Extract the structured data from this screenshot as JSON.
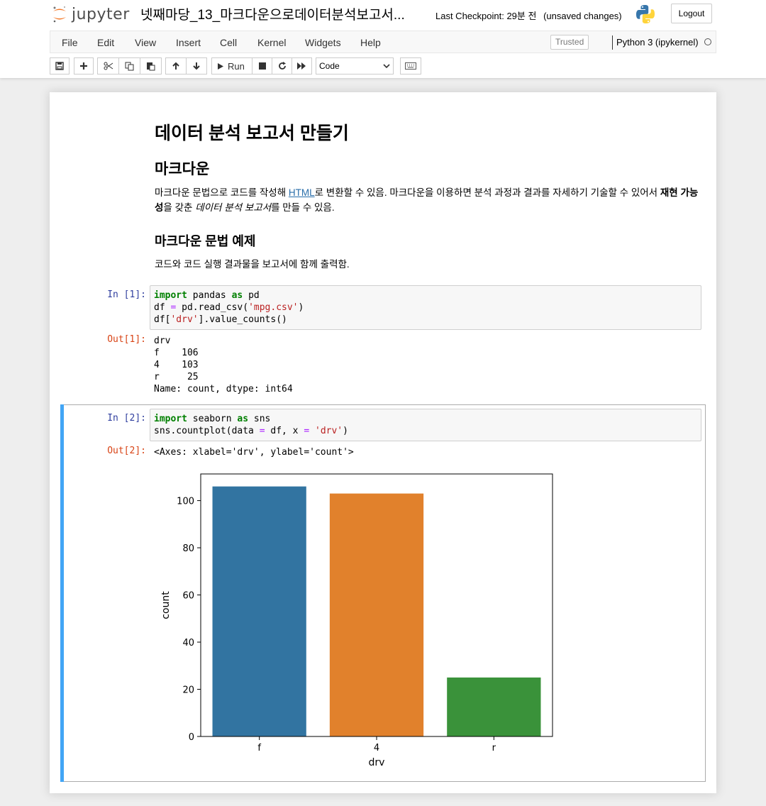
{
  "header": {
    "logo_text": "jupyter",
    "notebook_title": "넷째마당_13_마크다운으로데이터분석보고서...",
    "checkpoint": "Last Checkpoint: 29분 전",
    "unsaved": "(unsaved changes)",
    "logout_label": "Logout"
  },
  "menu": {
    "items": [
      "File",
      "Edit",
      "View",
      "Insert",
      "Cell",
      "Kernel",
      "Widgets",
      "Help"
    ],
    "trusted_label": "Trusted",
    "kernel_name": "Python 3 (ipykernel)"
  },
  "toolbar": {
    "run_label": "Run",
    "cell_type": "Code",
    "buttons": [
      "save-icon",
      "plus-icon",
      "cut-icon",
      "copy-icon",
      "paste-icon",
      "arrow-up-icon",
      "arrow-down-icon",
      "run-icon",
      "stop-icon",
      "restart-icon",
      "fast-forward-icon",
      "keyboard-icon"
    ]
  },
  "markdown": {
    "h1": "데이터 분석 보고서 만들기",
    "h2": "마크다운",
    "p1_a": "마크다운 문법으로 코드를 작성해 ",
    "p1_link": "HTML",
    "p1_b": "로 변환할 수 있음. 마크다운을 이용하면 분석 과정과 결과를 자세하기 기술할 수 있어서 ",
    "p1_bold": "재현 가능성",
    "p1_c": "을 갖춘 ",
    "p1_em": "데이터 분석 보고서",
    "p1_d": "를 만들 수 있음.",
    "h3": "마크다운 문법 예제",
    "p2": "코드와 코드 실행 결과물을 보고서에 함께 출력함."
  },
  "cells": {
    "in1_prompt": "In [1]:",
    "in1_line1_kw1": "import",
    "in1_line1_a": " pandas ",
    "in1_line1_kw2": "as",
    "in1_line1_b": " pd",
    "in1_line2_a": "df ",
    "in1_line2_op": "=",
    "in1_line2_b": " pd.read_csv(",
    "in1_line2_str": "'mpg.csv'",
    "in1_line2_c": ")",
    "in1_line3_a": "df[",
    "in1_line3_str": "'drv'",
    "in1_line3_b": "].value_counts()",
    "out1_prompt": "Out[1]:",
    "out1_text": "drv\nf    106\n4    103\nr     25\nName: count, dtype: int64",
    "in2_prompt": "In [2]:",
    "in2_line1_kw1": "import",
    "in2_line1_a": " seaborn ",
    "in2_line1_kw2": "as",
    "in2_line1_b": " sns",
    "in2_line2_a": "sns.countplot(data ",
    "in2_line2_op1": "=",
    "in2_line2_b": " df, x ",
    "in2_line2_op2": "=",
    "in2_line2_c": " ",
    "in2_line2_str": "'drv'",
    "in2_line2_d": ")",
    "out2_prompt": "Out[2]:",
    "out2_text": "<Axes: xlabel='drv', ylabel='count'>"
  },
  "chart_data": {
    "type": "bar",
    "categories": [
      "f",
      "4",
      "r"
    ],
    "values": [
      106,
      103,
      25
    ],
    "colors": [
      "#3274a1",
      "#e1812c",
      "#3a923a"
    ],
    "xlabel": "drv",
    "ylabel": "count",
    "ylim": [
      0,
      111.3
    ],
    "yticks": [
      0,
      20,
      40,
      60,
      80,
      100
    ]
  }
}
